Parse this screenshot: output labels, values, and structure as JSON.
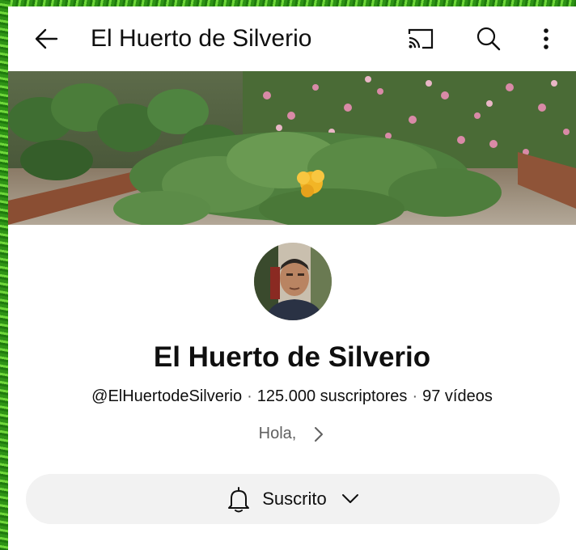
{
  "header": {
    "title": "El Huerto de Silverio"
  },
  "channel": {
    "name": "El Huerto de Silverio",
    "handle": "@ElHuertodeSilverio",
    "subscribers": "125.000 suscriptores",
    "videos": "97 vídeos",
    "separator": "·",
    "description": "Hola,"
  },
  "subscribe": {
    "label": "Suscrito"
  },
  "icons": {
    "back": "arrow-left-icon",
    "cast": "cast-icon",
    "search": "search-icon",
    "more": "more-vertical-icon",
    "bell": "bell-icon",
    "chevron_right": "chevron-right-icon",
    "chevron_down": "chevron-down-icon"
  },
  "colors": {
    "text_primary": "#0f0f0f",
    "text_secondary": "#606060",
    "button_bg": "#f2f2f2",
    "background": "#ffffff"
  }
}
